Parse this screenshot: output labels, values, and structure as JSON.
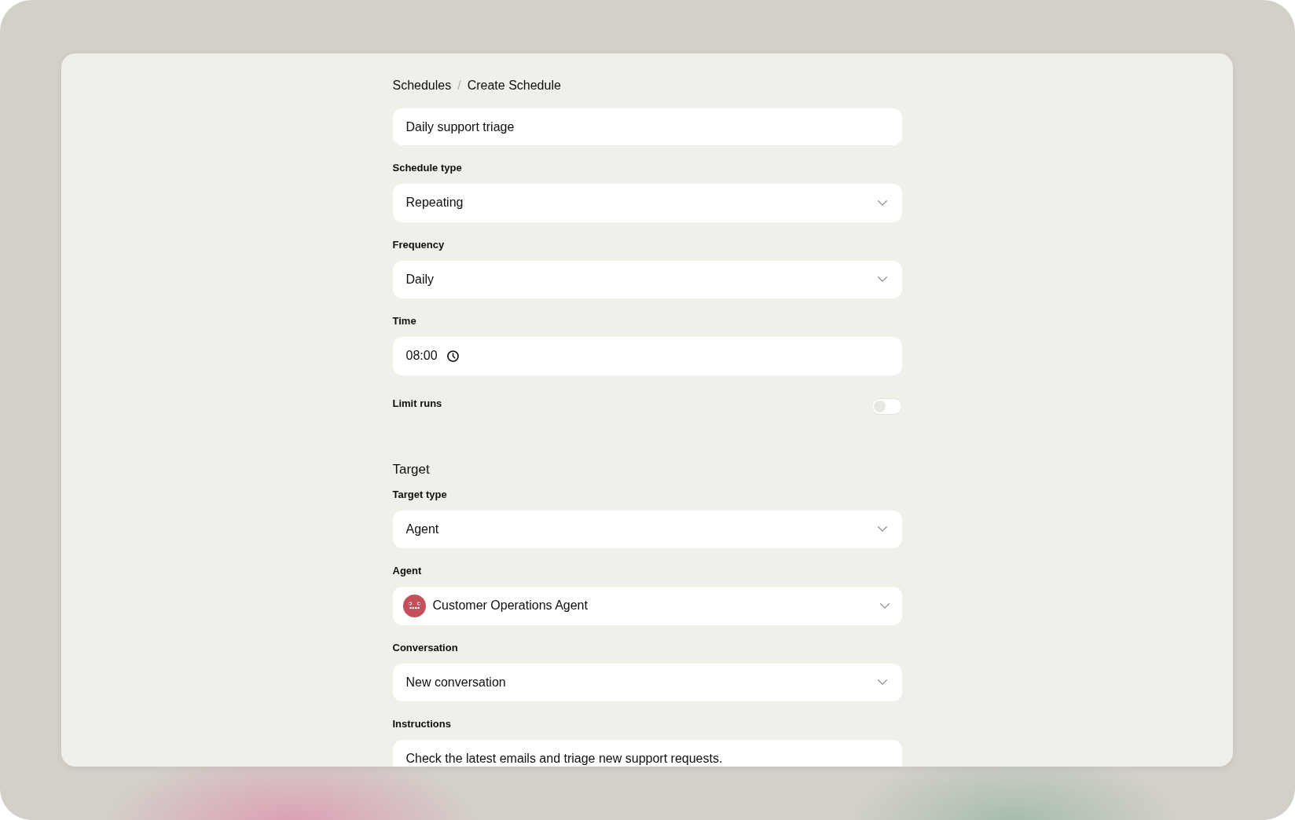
{
  "breadcrumb": {
    "items": [
      {
        "label": "Schedules"
      },
      {
        "label": "Create Schedule"
      }
    ],
    "separator": "/"
  },
  "name_field": {
    "value": "Daily support triage"
  },
  "schedule_fields": [
    {
      "kind": "select",
      "label": "Schedule type",
      "value": "Repeating"
    },
    {
      "kind": "select",
      "label": "Frequency",
      "value": "Daily"
    },
    {
      "kind": "time",
      "label": "Time",
      "value": "08:00"
    },
    {
      "kind": "toggle",
      "label": "Limit runs",
      "on": false
    }
  ],
  "target": {
    "heading": "Target",
    "fields": [
      {
        "kind": "select",
        "label": "Target type",
        "value": "Agent"
      },
      {
        "kind": "agent_select",
        "label": "Agent",
        "value": "Customer Operations Agent"
      },
      {
        "kind": "select",
        "label": "Conversation",
        "value": "New conversation"
      },
      {
        "kind": "textarea",
        "label": "Instructions",
        "value": "Check the latest emails and triage new support requests."
      }
    ]
  }
}
